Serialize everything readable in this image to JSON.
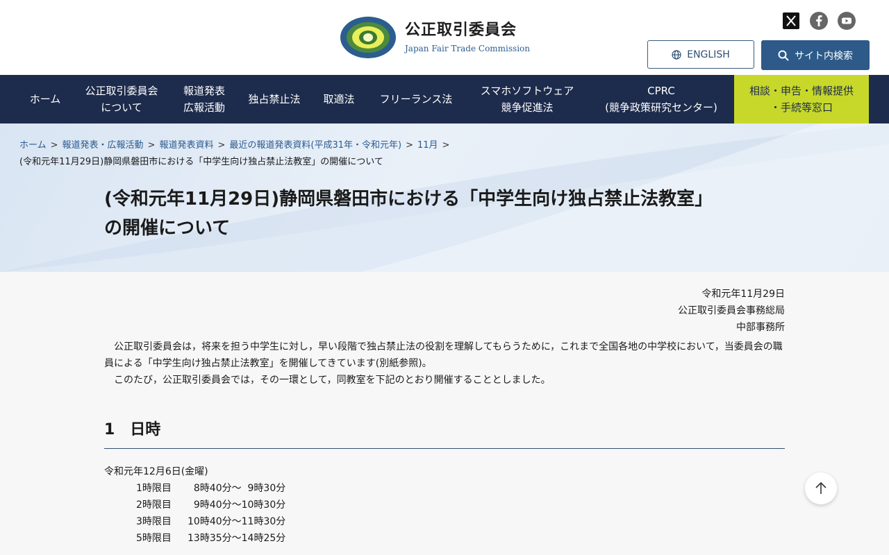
{
  "header": {
    "org_name_ja": "公正取引委員会",
    "org_name_en": "Japan Fair Trade Commission",
    "logo_ring_text": "JAPAN FAIR TRADE COMMISSION",
    "social_icons": [
      "x-icon",
      "facebook-icon",
      "youtube-icon"
    ],
    "english_label": "ENGLISH",
    "search_label": "サイト内検索"
  },
  "nav": {
    "items": [
      {
        "label": "ホーム"
      },
      {
        "label": "公正取引委員会\nについて"
      },
      {
        "label": "報道発表\n広報活動"
      },
      {
        "label": "独占禁止法"
      },
      {
        "label": "取適法"
      },
      {
        "label": "フリーランス法"
      },
      {
        "label": "スマホソフトウェア\n競争促進法"
      },
      {
        "label": "CPRC\n(競争政策研究センター)"
      },
      {
        "label": "相談・申告・情報提供\n・手続等窓口"
      }
    ]
  },
  "breadcrumb": {
    "items": [
      "ホーム",
      "報道発表・広報活動",
      "報道発表資料",
      "最近の報道発表資料(平成31年・令和元年)",
      "11月"
    ],
    "separator": ">",
    "current": "(令和元年11月29日)静岡県磐田市における「中学生向け独占禁止法教室」の開催について"
  },
  "page": {
    "title_line1": "(令和元年11月29日)静岡県磐田市における「中学生向け独占禁止法教室」",
    "title_line2": "の開催について",
    "date": "令和元年11月29日",
    "issuer": "公正取引委員会事務総局",
    "office": "中部事務所",
    "paragraph1": "公正取引委員会は，将来を担う中学生に対し，早い段階で独占禁止法の役割を理解してもらうために，これまで全国各地の中学校において，当委員会の職員による「中学生向け独占禁止法教室」を開催してきています(別紙参照)。",
    "paragraph2": "このたび，公正取引委員会では，その一環として，同教室を下記のとおり開催することとしました。",
    "section1_heading": "1　日時",
    "schedule_date": "令和元年12月6日(金曜)",
    "schedule": [
      {
        "period": "1時限目",
        "time": "  8時40分～  9時30分"
      },
      {
        "period": "2時限目",
        "time": "  9時40分～10時30分"
      },
      {
        "period": "3時限目",
        "time": "10時40分～11時30分"
      },
      {
        "period": "5時限目",
        "time": "13時35分～14時25分"
      }
    ]
  },
  "colors": {
    "nav_bg": "#1d2b4c",
    "nav_highlight": "#c7d82a",
    "accent": "#2d5a88",
    "link": "#2a5a8e"
  }
}
